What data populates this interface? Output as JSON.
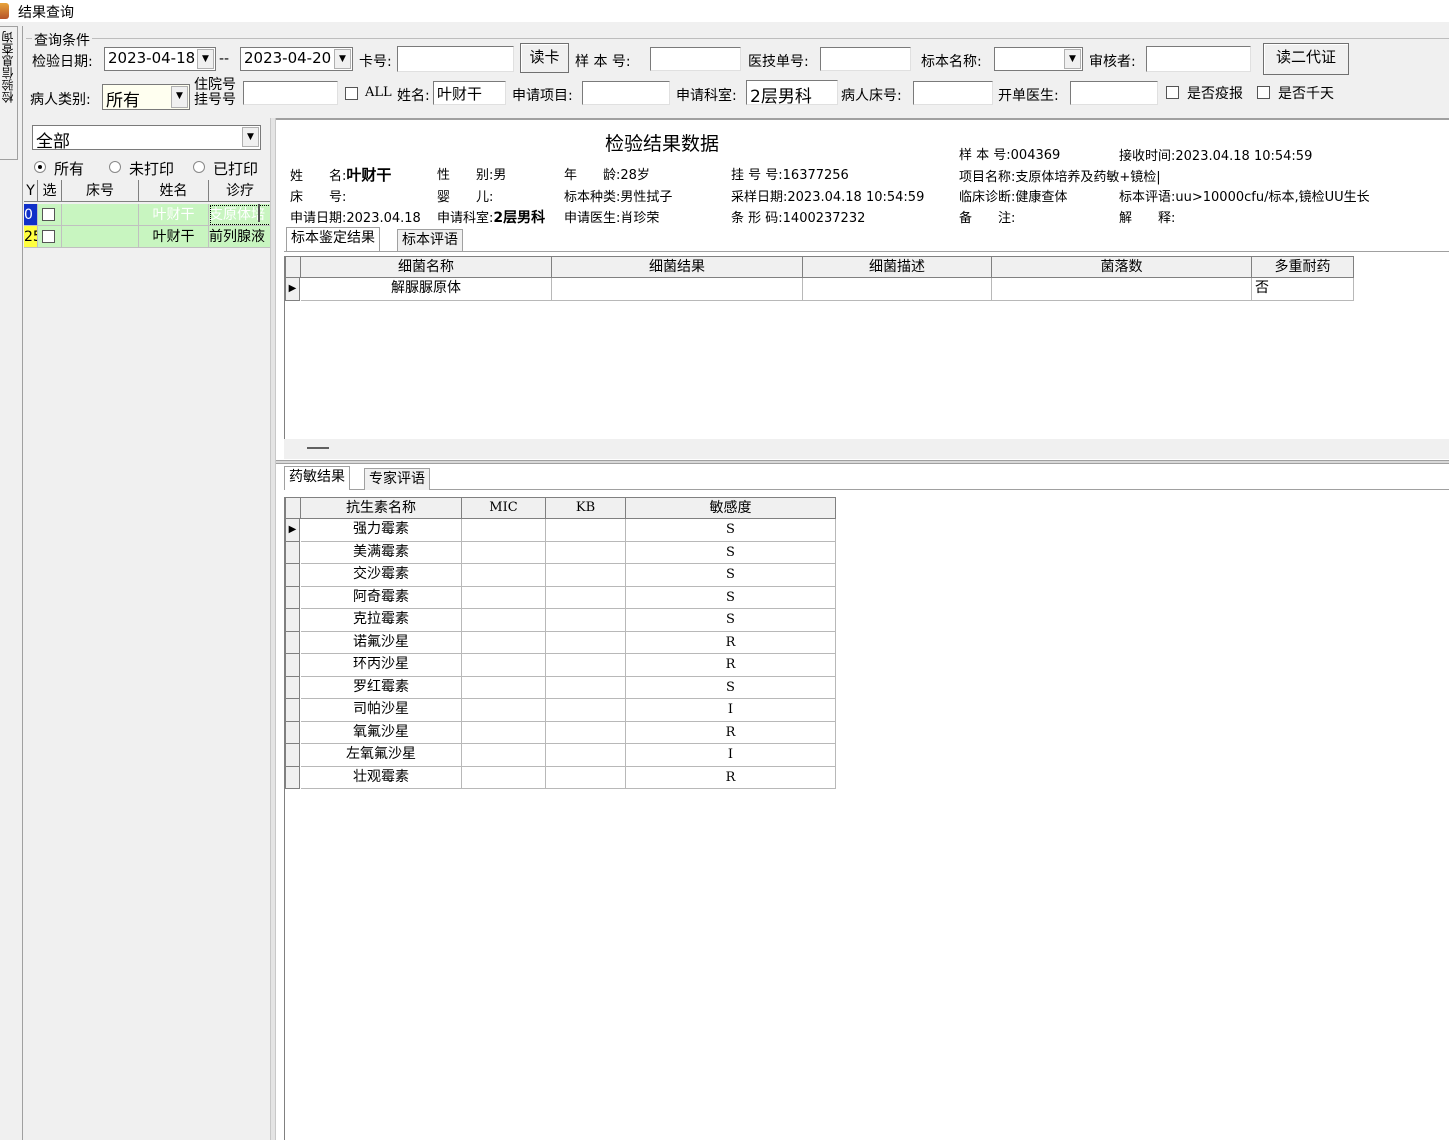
{
  "window": {
    "title": "结果查询"
  },
  "vertical_tab": {
    "label": "检验信息查询"
  },
  "query": {
    "group_label": "查询条件",
    "test_date_label": "检验日期:",
    "date_from": "2023-04-18",
    "date_sep": "--",
    "date_to": "2023-04-20",
    "card_label": "卡号:",
    "card_value": "",
    "read_card_button": "读卡",
    "sample_no_label": "样 本 号:",
    "sample_no_value": "",
    "tech_no_label": "医技单号:",
    "tech_no_value": "",
    "specimen_name_label": "标本名称:",
    "specimen_name_value": "",
    "reviewer_label": "审核者:",
    "reviewer_value": "",
    "read_id_button": "读二代证",
    "patient_type_label": "病人类别:",
    "patient_type_value": "所有",
    "inpatient_label_1": "住院号",
    "inpatient_label_2": "挂号号",
    "inpatient_value": "",
    "all_label": "ALL",
    "name_label": "姓名:",
    "name_value": "叶财干",
    "request_item_label": "申请项目:",
    "request_item_value": "",
    "request_dept_label": "申请科室:",
    "request_dept_value": "2层男科",
    "bed_no_label": "病人床号:",
    "bed_no_value": "",
    "doctor_label": "开单医生:",
    "doctor_value": "",
    "epidemic_label": "是否疫报",
    "thousand_days_label": "是否千天"
  },
  "left": {
    "filter_value": "全部",
    "radio_all": "所有",
    "radio_unprinted": "未打印",
    "radio_printed": "已打印",
    "columns": [
      "Y",
      "选",
      "床号",
      "姓名",
      "诊疗"
    ],
    "rows": [
      {
        "y": "0",
        "bed": "",
        "name": "叶财干",
        "diag": "支原体培",
        "selected": true
      },
      {
        "y": "25",
        "bed": "",
        "name": "叶财干",
        "diag": "前列腺液",
        "selected": false
      }
    ]
  },
  "result": {
    "heading": "检验结果数据",
    "name_label": "姓　　名:",
    "name_value": "叶财干",
    "sex_label": "性　　别:",
    "sex_value": "男",
    "age_label": "年　　龄:",
    "age_value": "28岁",
    "reg_no_label": "挂 号 号:",
    "reg_no_value": "16377256",
    "bed_label": "床　　号:",
    "bed_value": "",
    "infant_label": "婴　　儿:",
    "infant_value": "",
    "specimen_type_label": "标本种类:",
    "specimen_type_value": "男性拭子",
    "collect_date_label": "采样日期:",
    "collect_date_value": "2023.04.18 10:54:59",
    "apply_date_label": "申请日期:",
    "apply_date_value": "2023.04.18",
    "apply_dept_label": "申请科室:",
    "apply_dept_value": "2层男科",
    "apply_doctor_label": "申请医生:",
    "apply_doctor_value": "肖珍荣",
    "barcode_label": "条 形 码:",
    "barcode_value": "1400237232",
    "sample_no_label": "样 本 号:",
    "sample_no_value": "004369",
    "receive_time_label": "接收时间:",
    "receive_time_value": "2023.04.18 10:54:59",
    "project_label": "项目名称:",
    "project_value": "支原体培养及药敏+镜检|",
    "diagnosis_label": "临床诊断:",
    "diagnosis_value": "健康查体",
    "comment_label": "标本评语:",
    "comment_value": "uu>10000cfu/标本,镜检UU生长",
    "remark_label": "备　　注:",
    "remark_value": "",
    "explain_label": "解　　释:",
    "explain_value": ""
  },
  "tabs_top": [
    "标本鉴定结果",
    "标本评语"
  ],
  "bacteria_grid": {
    "columns": [
      "细菌名称",
      "细菌结果",
      "细菌描述",
      "菌落数",
      "多重耐药"
    ],
    "rows": [
      {
        "name": "解脲脲原体",
        "result": "",
        "desc": "",
        "count": "",
        "mdr": "否"
      }
    ]
  },
  "tabs_bottom": [
    "药敏结果",
    "专家评语"
  ],
  "antibiotic_grid": {
    "columns": [
      "抗生素名称",
      "MIC",
      "KB",
      "敏感度"
    ],
    "rows": [
      {
        "name": "强力霉素",
        "mic": "",
        "kb": "",
        "sens": "S"
      },
      {
        "name": "美满霉素",
        "mic": "",
        "kb": "",
        "sens": "S"
      },
      {
        "name": "交沙霉素",
        "mic": "",
        "kb": "",
        "sens": "S"
      },
      {
        "name": "阿奇霉素",
        "mic": "",
        "kb": "",
        "sens": "S"
      },
      {
        "name": "克拉霉素",
        "mic": "",
        "kb": "",
        "sens": "S"
      },
      {
        "name": "诺氟沙星",
        "mic": "",
        "kb": "",
        "sens": "R"
      },
      {
        "name": "环丙沙星",
        "mic": "",
        "kb": "",
        "sens": "R"
      },
      {
        "name": "罗红霉素",
        "mic": "",
        "kb": "",
        "sens": "S"
      },
      {
        "name": "司帕沙星",
        "mic": "",
        "kb": "",
        "sens": "I"
      },
      {
        "name": "氧氟沙星",
        "mic": "",
        "kb": "",
        "sens": "R"
      },
      {
        "name": "左氧氟沙星",
        "mic": "",
        "kb": "",
        "sens": "I"
      },
      {
        "name": "壮观霉素",
        "mic": "",
        "kb": "",
        "sens": "R"
      }
    ]
  },
  "colors": {
    "row_green": "#c8f5c0",
    "row_selected_blue": "#1030c8",
    "row_yellow": "#ffff40"
  }
}
